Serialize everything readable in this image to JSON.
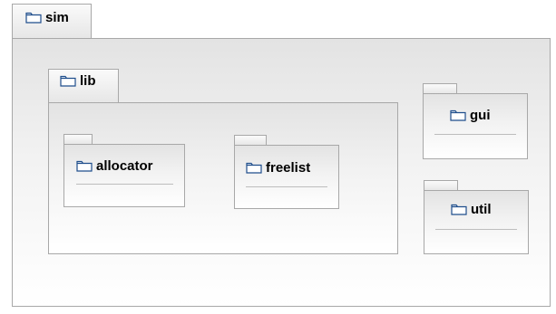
{
  "packages": {
    "sim": {
      "name": "sim"
    },
    "lib": {
      "name": "lib"
    },
    "allocator": {
      "name": "allocator"
    },
    "freelist": {
      "name": "freelist"
    },
    "gui": {
      "name": "gui"
    },
    "util": {
      "name": "util"
    }
  },
  "icons": {
    "package": "folder-icon"
  },
  "colors": {
    "border": "#a8a8a8",
    "icon_stroke": "#1f4e8c"
  }
}
